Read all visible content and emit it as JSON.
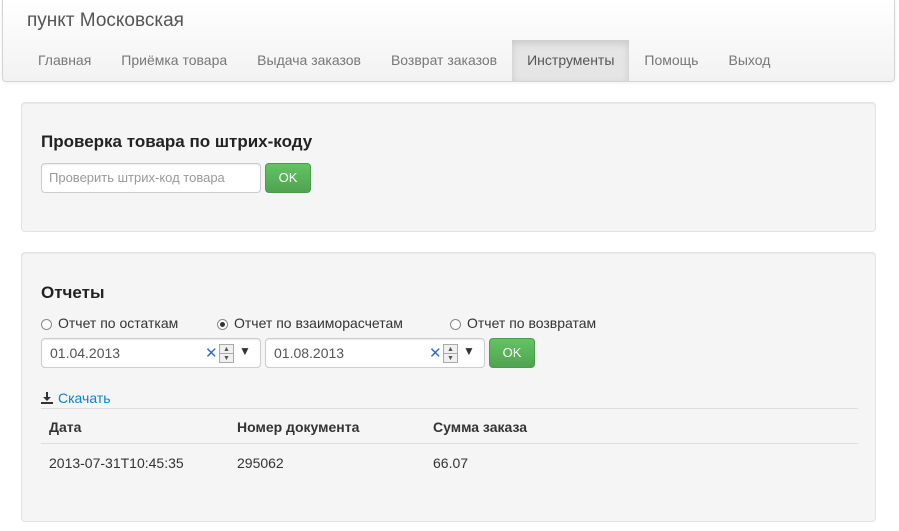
{
  "app": {
    "title": "пункт Московская"
  },
  "nav": {
    "items": [
      {
        "label": "Главная"
      },
      {
        "label": "Приёмка товара"
      },
      {
        "label": "Выдача заказов"
      },
      {
        "label": "Возврат заказов"
      },
      {
        "label": "Инструменты",
        "active": true
      },
      {
        "label": "Помощь"
      },
      {
        "label": "Выход"
      }
    ]
  },
  "barcode": {
    "heading": "Проверка товара по штрих-коду",
    "placeholder": "Проверить штрих-код товара",
    "ok_label": "OK"
  },
  "reports": {
    "heading": "Отчеты",
    "radios": [
      {
        "label": "Отчет по остаткам",
        "checked": false
      },
      {
        "label": "Отчет по взаиморасчетам",
        "checked": true
      },
      {
        "label": "Отчет по возвратам",
        "checked": false
      }
    ],
    "date_from": "01.04.2013",
    "date_to": "01.08.2013",
    "clear_icon": "✕",
    "ok_label": "OK",
    "download_label": "Скачать",
    "table": {
      "headers": [
        "Дата",
        "Номер документа",
        "Сумма заказа"
      ],
      "rows": [
        [
          "2013-07-31T10:45:35",
          "295062",
          "66.07"
        ]
      ]
    }
  },
  "colors": {
    "accent_link": "#0088cc",
    "ok_button": "#51a351",
    "nav_active": "#e5e5e5"
  }
}
